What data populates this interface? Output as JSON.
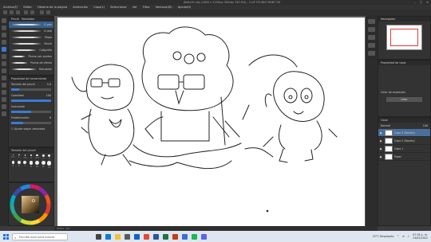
{
  "window": {
    "title": "Sketch*.clip (1800 x 1200px 350dpi 150.0%) - CLIP STUDIO PAINT EX"
  },
  "menu": [
    "Archivo(F)",
    "Editar",
    "Historia de la página",
    "Animación",
    "Capa(L)",
    "Seleccionar",
    "Ver",
    "Filtro",
    "Ventana(W)",
    "Ayuda(H)"
  ],
  "subtool": {
    "tabs": [
      "Pincel",
      "Rotulador"
    ],
    "brushes": [
      {
        "label": "G-pen",
        "selected": true
      },
      {
        "label": "G-real",
        "selected": false
      },
      {
        "label": "Mapa",
        "selected": false
      },
      {
        "label": "Brush",
        "selected": false
      },
      {
        "label": "Caligrafía",
        "selected": false
      },
      {
        "label": "Pluma con puntas",
        "selected": false
      },
      {
        "label": "Pluma de efecto",
        "selected": false
      },
      {
        "label": "Rotulador",
        "selected": false
      }
    ]
  },
  "toolprop": {
    "title": "Propiedad de herramienta",
    "rows": [
      {
        "label": "Tamaño del pincel",
        "value": "5.0",
        "fill": 0.2
      },
      {
        "label": "Opacidad",
        "value": "100",
        "fill": 1.0
      },
      {
        "label": "Suavizado",
        "value": "",
        "fill": 0.5
      },
      {
        "label": "Estabilización",
        "value": "6",
        "fill": 0.3
      }
    ],
    "checkbox": "Ajuste según velocidad"
  },
  "brushsize": {
    "title": "Tamaño del pincel",
    "sizes": [
      "0.7",
      "1",
      "1.5",
      "2",
      "2.5",
      "3",
      "4",
      "5",
      "6",
      "7",
      "8",
      "10",
      "12",
      "15"
    ]
  },
  "colors": {
    "accent": "#3d7bd5",
    "wheel_main": "#8a6a3a",
    "selection": "#4a6f9a"
  },
  "navigator": {
    "title": "Navegador"
  },
  "layerprop": {
    "title": "Propiedad de capa",
    "expression": "Color de expresión",
    "button": "Color"
  },
  "layers": {
    "title": "Capa",
    "blend": "Normal",
    "opacity": "100",
    "items": [
      {
        "name": "Capa 3 (Boceto)",
        "selected": true
      },
      {
        "name": "Capa 2 (Boceto)",
        "selected": false
      },
      {
        "name": "Capa 1",
        "selected": false
      },
      {
        "name": "Papel",
        "selected": false
      }
    ]
  },
  "statusbar": {
    "zoom": "150.0",
    "angle": "0.0"
  },
  "taskbar": {
    "search_placeholder": "Escribe aquí para buscar",
    "weather": "22°C Despejado",
    "time": "07:18 p. m.",
    "date": "24/05/2022",
    "icons": [
      "task-view",
      "edge",
      "file-explorer",
      "store",
      "mail",
      "chrome",
      "word",
      "excel",
      "powerpoint",
      "clip-studio",
      "spotify",
      "discord"
    ]
  }
}
